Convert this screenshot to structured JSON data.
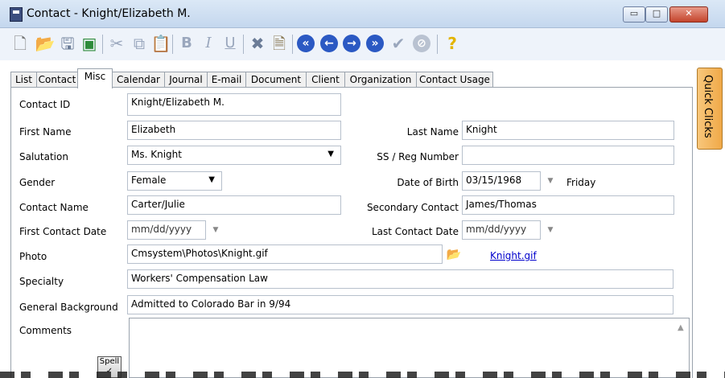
{
  "window": {
    "title": "Contact - Knight/Elizabeth M.",
    "controls": {
      "minimize": "▭",
      "maximize": "□",
      "close": "✕"
    }
  },
  "toolbar": {
    "icons": [
      "new-icon",
      "open-icon",
      "save-icon",
      "save-close-icon",
      "cut-icon",
      "copy-icon",
      "paste-icon",
      "bold-icon",
      "italic-icon",
      "underline-icon",
      "delete-icon",
      "attach-icon",
      "first-record-icon",
      "previous-record-icon",
      "next-record-icon",
      "last-record-icon",
      "check-icon",
      "cancel-icon",
      "help-icon"
    ],
    "bold": "B",
    "italic": "I",
    "underline": "U",
    "help": "?"
  },
  "tabs": [
    {
      "label": "List",
      "active": false
    },
    {
      "label": "Contact",
      "active": false
    },
    {
      "label": "Misc",
      "active": true
    },
    {
      "label": "Calendar",
      "active": false
    },
    {
      "label": "Journal",
      "active": false
    },
    {
      "label": "E-mail",
      "active": false
    },
    {
      "label": "Document",
      "active": false
    },
    {
      "label": "Client",
      "active": false
    },
    {
      "label": "Organization",
      "active": false
    },
    {
      "label": "Contact Usage",
      "active": false
    }
  ],
  "quick_clicks": "Quick Clicks",
  "form": {
    "contact_id": {
      "label": "Contact ID",
      "value": "Knight/Elizabeth M."
    },
    "first_name": {
      "label": "First Name",
      "value": "Elizabeth"
    },
    "last_name": {
      "label": "Last Name",
      "value": "Knight"
    },
    "salutation": {
      "label": "Salutation",
      "value": "Ms. Knight"
    },
    "ss_reg_number": {
      "label": "SS / Reg Number",
      "value": ""
    },
    "gender": {
      "label": "Gender",
      "value": "Female"
    },
    "date_of_birth": {
      "label": "Date of Birth",
      "value": "03/15/1968",
      "weekday": "Friday"
    },
    "contact_name": {
      "label": "Contact Name",
      "value": "Carter/Julie"
    },
    "secondary_contact": {
      "label": "Secondary Contact",
      "value": "James/Thomas"
    },
    "first_contact_date": {
      "label": "First Contact Date",
      "value": "mm/dd/yyyy"
    },
    "last_contact_date": {
      "label": "Last Contact Date",
      "value": "mm/dd/yyyy"
    },
    "photo": {
      "label": "Photo",
      "value": "Cmsystem\\Photos\\Knight.gif",
      "link": "Knight.gif"
    },
    "specialty": {
      "label": "Specialty",
      "value": "Workers' Compensation Law"
    },
    "general_background": {
      "label": "General Background",
      "value": "Admitted to Colorado Bar in 9/94"
    },
    "comments": {
      "label": "Comments",
      "value": ""
    },
    "spell_label": "Spell"
  }
}
